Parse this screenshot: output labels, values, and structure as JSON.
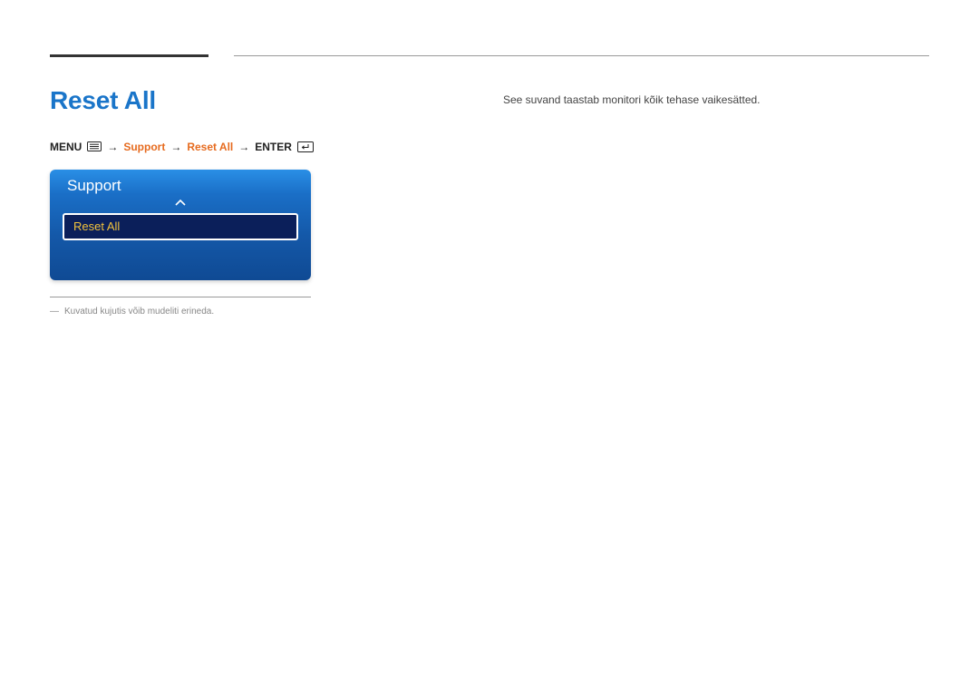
{
  "page": {
    "title": "Reset All"
  },
  "navPath": {
    "menu": "MENU",
    "arrow": "→",
    "support": "Support",
    "resetAll": "Reset All",
    "enter": "ENTER"
  },
  "osd": {
    "title": "Support",
    "selectedItem": "Reset All"
  },
  "footnote": {
    "dash": "―",
    "text": "Kuvatud kujutis võib mudeliti erineda."
  },
  "description": "See suvand taastab monitori kõik tehase vaikesätted."
}
